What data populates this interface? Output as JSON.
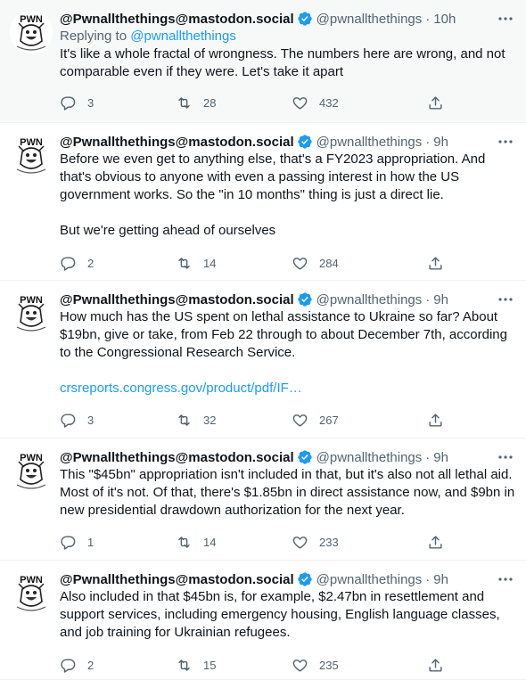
{
  "author": {
    "name": "@Pwnallthethings@mastodon.social",
    "handle": "@pwnallthethings"
  },
  "colors": {
    "accent": "#1d9bf0",
    "secondary": "#536471",
    "text": "#0f1419"
  },
  "icons": {
    "avatar": "pwn-cartoon-avatar",
    "verified": "verified-badge-icon",
    "more": "more-horizontal-icon",
    "reply": "reply-icon",
    "retweet": "retweet-icon",
    "like": "heart-icon",
    "share": "share-icon"
  },
  "tweets": [
    {
      "time": "10h",
      "replying_prefix": "Replying to",
      "replying_to": "@pwnallthethings",
      "paragraphs": [
        "It's like a whole fractal of wrongness. The numbers here are wrong, and not comparable even if they were. Let's take it apart"
      ],
      "replies": "3",
      "retweets": "28",
      "likes": "432"
    },
    {
      "time": "9h",
      "paragraphs": [
        "Before we even get to anything else, that's a FY2023 appropriation. And that's obvious to anyone with even a passing interest in how the US government works. So the \"in 10 months\" thing is just a direct lie.",
        "But we're getting ahead of ourselves"
      ],
      "replies": "2",
      "retweets": "14",
      "likes": "284"
    },
    {
      "time": "9h",
      "paragraphs": [
        "How much has the US spent on lethal assistance to Ukraine so far? About $19bn, give or take, from Feb 22 through to about December 7th, according to the Congressional Research Service."
      ],
      "link": "crsreports.congress.gov/product/pdf/IF…",
      "replies": "3",
      "retweets": "32",
      "likes": "267"
    },
    {
      "time": "9h",
      "paragraphs": [
        "This \"$45bn\" appropriation isn't included in that, but it's also not all lethal aid. Most of it's not. Of that, there's $1.85bn in direct assistance now, and $9bn in new presidential drawdown authorization for the next year."
      ],
      "replies": "1",
      "retweets": "14",
      "likes": "233"
    },
    {
      "time": "9h",
      "paragraphs": [
        "Also included in that $45bn is, for example, $2.47bn in resettlement and support services, including emergency housing, English language classes, and job training for Ukrainian refugees."
      ],
      "replies": "2",
      "retweets": "15",
      "likes": "235"
    }
  ]
}
